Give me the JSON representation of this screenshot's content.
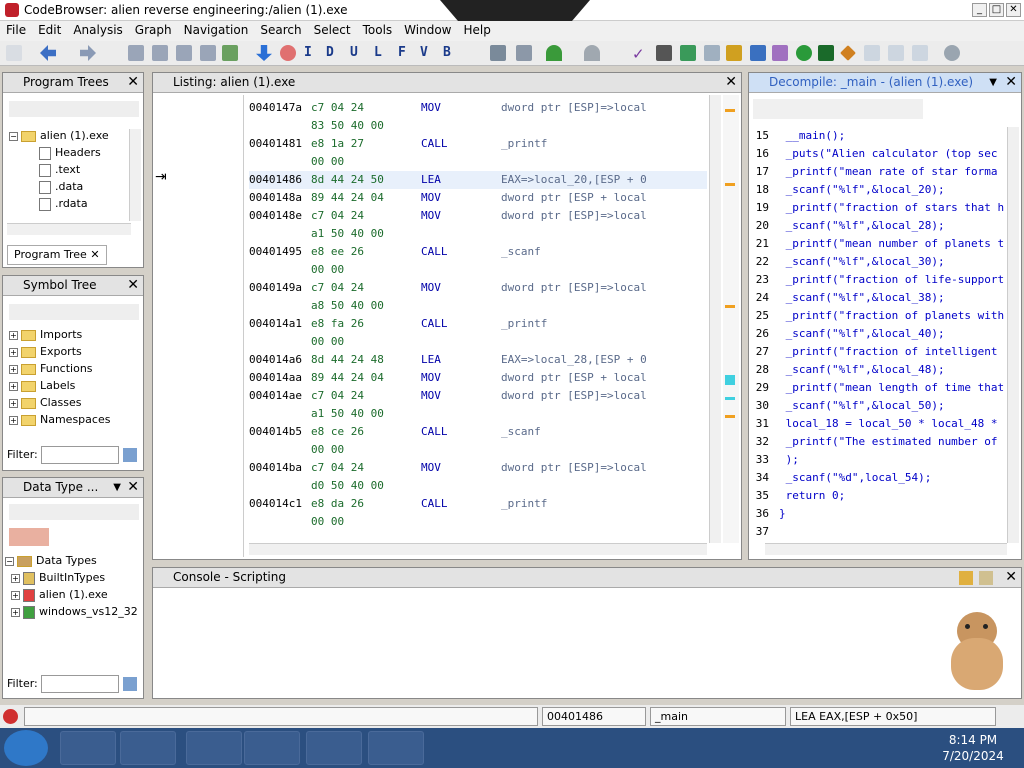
{
  "window": {
    "title": "CodeBrowser: alien reverse engineering:/alien (1).exe"
  },
  "menu": [
    "File",
    "Edit",
    "Analysis",
    "Graph",
    "Navigation",
    "Search",
    "Select",
    "Tools",
    "Window",
    "Help"
  ],
  "toolbar": {
    "letters": [
      "I",
      "D",
      "U",
      "L",
      "F",
      "V",
      "B"
    ]
  },
  "program_trees": {
    "title": "Program Trees",
    "items": [
      "alien (1).exe",
      "Headers",
      ".text",
      ".data",
      ".rdata"
    ],
    "tab": "Program Tree"
  },
  "symbol_tree": {
    "title": "Symbol Tree",
    "items": [
      "Imports",
      "Exports",
      "Functions",
      "Labels",
      "Classes",
      "Namespaces"
    ],
    "filter_label": "Filter:"
  },
  "data_types": {
    "title": "Data Type ...",
    "root": "Data Types",
    "items": [
      "BuiltInTypes",
      "alien (1).exe",
      "windows_vs12_32"
    ],
    "filter_label": "Filter:"
  },
  "listing": {
    "title": "Listing:  alien (1).exe",
    "rows": [
      {
        "addr": "0040147a",
        "bytes": "c7 04 24",
        "mn": "MOV",
        "ops": "dword ptr [ESP]=>local"
      },
      {
        "addr": "",
        "bytes": "83 50 40 00",
        "mn": "",
        "ops": ""
      },
      {
        "addr": "00401481",
        "bytes": "e8 1a 27",
        "mn": "CALL",
        "ops": "_printf"
      },
      {
        "addr": "",
        "bytes": "00 00",
        "mn": "",
        "ops": ""
      },
      {
        "addr": "00401486",
        "bytes": "8d 44 24 50",
        "mn": "LEA",
        "ops": "EAX=>local_20,[ESP + 0"
      },
      {
        "addr": "0040148a",
        "bytes": "89 44 24 04",
        "mn": "MOV",
        "ops": "dword ptr [ESP + local"
      },
      {
        "addr": "0040148e",
        "bytes": "c7 04 24",
        "mn": "MOV",
        "ops": "dword ptr [ESP]=>local"
      },
      {
        "addr": "",
        "bytes": "a1 50 40 00",
        "mn": "",
        "ops": ""
      },
      {
        "addr": "00401495",
        "bytes": "e8 ee 26",
        "mn": "CALL",
        "ops": "_scanf"
      },
      {
        "addr": "",
        "bytes": "00 00",
        "mn": "",
        "ops": ""
      },
      {
        "addr": "0040149a",
        "bytes": "c7 04 24",
        "mn": "MOV",
        "ops": "dword ptr [ESP]=>local"
      },
      {
        "addr": "",
        "bytes": "a8 50 40 00",
        "mn": "",
        "ops": ""
      },
      {
        "addr": "004014a1",
        "bytes": "e8 fa 26",
        "mn": "CALL",
        "ops": "_printf"
      },
      {
        "addr": "",
        "bytes": "00 00",
        "mn": "",
        "ops": ""
      },
      {
        "addr": "004014a6",
        "bytes": "8d 44 24 48",
        "mn": "LEA",
        "ops": "EAX=>local_28,[ESP + 0"
      },
      {
        "addr": "004014aa",
        "bytes": "89 44 24 04",
        "mn": "MOV",
        "ops": "dword ptr [ESP + local"
      },
      {
        "addr": "004014ae",
        "bytes": "c7 04 24",
        "mn": "MOV",
        "ops": "dword ptr [ESP]=>local"
      },
      {
        "addr": "",
        "bytes": "a1 50 40 00",
        "mn": "",
        "ops": ""
      },
      {
        "addr": "004014b5",
        "bytes": "e8 ce 26",
        "mn": "CALL",
        "ops": "_scanf"
      },
      {
        "addr": "",
        "bytes": "00 00",
        "mn": "",
        "ops": ""
      },
      {
        "addr": "004014ba",
        "bytes": "c7 04 24",
        "mn": "MOV",
        "ops": "dword ptr [ESP]=>local"
      },
      {
        "addr": "",
        "bytes": "d0 50 40 00",
        "mn": "",
        "ops": ""
      },
      {
        "addr": "004014c1",
        "bytes": "e8 da 26",
        "mn": "CALL",
        "ops": "_printf"
      },
      {
        "addr": "",
        "bytes": "00 00",
        "mn": "",
        "ops": ""
      }
    ]
  },
  "decompile": {
    "title": "Decompile: _main - (alien (1).exe)",
    "lines": [
      {
        "n": "15",
        "t": "  __main();"
      },
      {
        "n": "16",
        "t": "  _puts(\"Alien calculator (top sec"
      },
      {
        "n": "17",
        "t": "  _printf(\"mean rate of star forma"
      },
      {
        "n": "18",
        "t": "  _scanf(\"%lf\",&local_20);"
      },
      {
        "n": "19",
        "t": "  _printf(\"fraction of stars that h"
      },
      {
        "n": "20",
        "t": "  _scanf(\"%lf\",&local_28);"
      },
      {
        "n": "21",
        "t": "  _printf(\"mean number of planets t"
      },
      {
        "n": "22",
        "t": "  _scanf(\"%lf\",&local_30);"
      },
      {
        "n": "23",
        "t": "  _printf(\"fraction of life-support"
      },
      {
        "n": "24",
        "t": "  _scanf(\"%lf\",&local_38);"
      },
      {
        "n": "25",
        "t": "  _printf(\"fraction of planets with"
      },
      {
        "n": "26",
        "t": "  _scanf(\"%lf\",&local_40);"
      },
      {
        "n": "27",
        "t": "  _printf(\"fraction of intelligent"
      },
      {
        "n": "28",
        "t": "  _scanf(\"%lf\",&local_48);"
      },
      {
        "n": "29",
        "t": "  _printf(\"mean length of time that"
      },
      {
        "n": "30",
        "t": "  _scanf(\"%lf\",&local_50);"
      },
      {
        "n": "31",
        "t": "  local_18 = local_50 * local_48 *"
      },
      {
        "n": "32",
        "t": "  _printf(\"The estimated number of"
      },
      {
        "n": "33",
        "t": "         );"
      },
      {
        "n": "34",
        "t": "  _scanf(\"%d\",local_54);"
      },
      {
        "n": "35",
        "t": "  return 0;"
      },
      {
        "n": "36",
        "t": "}"
      },
      {
        "n": "37",
        "t": ""
      }
    ]
  },
  "console": {
    "title": "Console - Scripting"
  },
  "status": {
    "addr": "00401486",
    "func": "_main",
    "instr": "LEA EAX,[ESP + 0x50]"
  },
  "taskbar": {
    "time": "8:14 PM",
    "date": "7/20/2024"
  }
}
